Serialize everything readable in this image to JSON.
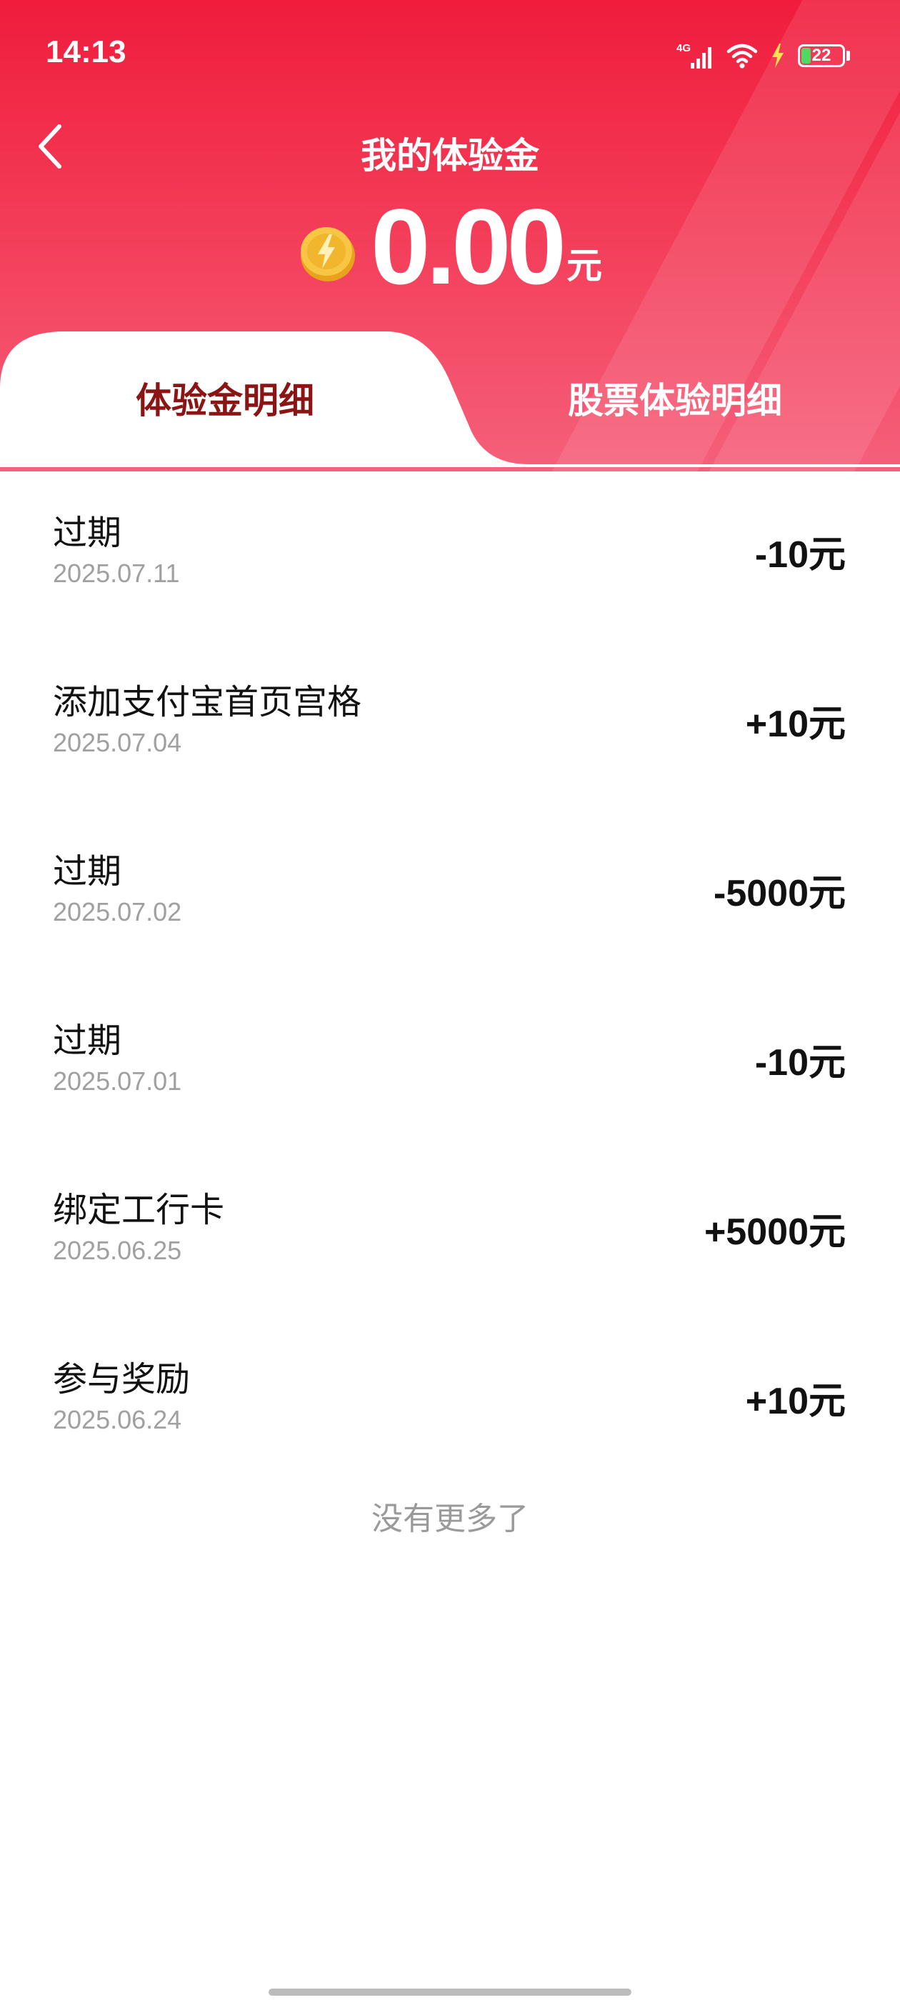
{
  "status_bar": {
    "time": "14:13",
    "network": "4G",
    "battery": "22",
    "battery_level": 0.22
  },
  "header": {
    "title": "我的体验金",
    "balance": "0.00",
    "unit": "元"
  },
  "tabs": [
    {
      "label": "体验金明细",
      "active": true
    },
    {
      "label": "股票体验明细",
      "active": false
    }
  ],
  "records": [
    {
      "title": "过期",
      "date": "2025.07.11",
      "amount": "-10元"
    },
    {
      "title": "添加支付宝首页宫格",
      "date": "2025.07.04",
      "amount": "+10元"
    },
    {
      "title": "过期",
      "date": "2025.07.02",
      "amount": "-5000元"
    },
    {
      "title": "过期",
      "date": "2025.07.01",
      "amount": "-10元"
    },
    {
      "title": "绑定工行卡",
      "date": "2025.06.25",
      "amount": "+5000元"
    },
    {
      "title": "参与奖励",
      "date": "2025.06.24",
      "amount": "+10元"
    }
  ],
  "footer": {
    "no_more": "没有更多了"
  },
  "colors": {
    "brand_red": "#f01c3c",
    "tab_active_text": "#8b1414",
    "date_gray": "#a0a0a0"
  },
  "icons": {
    "back": "chevron-left-icon",
    "coin": "coin-icon",
    "signal": "signal-icon",
    "wifi": "wifi-icon",
    "charging": "lightning-icon",
    "battery": "battery-icon"
  }
}
